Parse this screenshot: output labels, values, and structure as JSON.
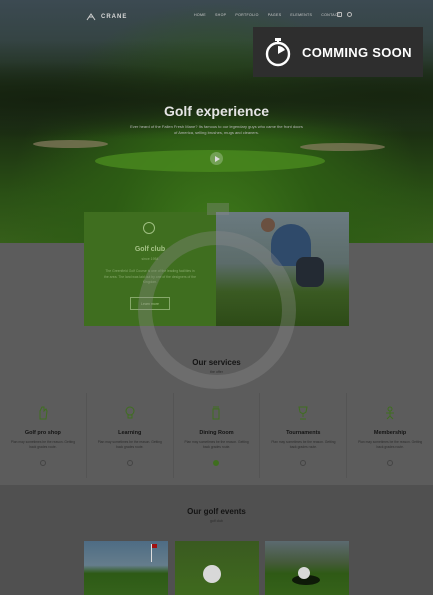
{
  "nav": {
    "logo_text": "CRANE",
    "menu": [
      "HOME",
      "SHOP",
      "PORTFOLIO",
      "PAGES",
      "ELEMENTS",
      "CONTACT"
    ]
  },
  "hero": {
    "title": "Golf experience",
    "subtitle": "Ever heard of the Fallen Fresh Mane? Its famous to our legendary guys who came the front doors of America, selling brushes, mugs and cleaners."
  },
  "badge": {
    "label": "COMMING SOON"
  },
  "club": {
    "title": "Golf club",
    "subtitle": "since 1954",
    "text": "The Greenfield Golf Course is one of the leading facilities in the area. The land was laid out by one of the designers of the Kingdom.",
    "button": "Learn more"
  },
  "services": {
    "title": "Our services",
    "subtitle": "the offer",
    "items": [
      {
        "title": "Golf pro shop",
        "text": "Plan may sometimes be the reason. Getting back grades route.",
        "icon": "glove-icon"
      },
      {
        "title": "Learning",
        "text": "Plan may sometimes be the reason. Getting back grades route.",
        "icon": "lightbulb-icon"
      },
      {
        "title": "Dining Room",
        "text": "Plan may sometimes be the reason. Getting back grades route.",
        "icon": "golf-bag-icon"
      },
      {
        "title": "Tournaments",
        "text": "Plan may sometimes be the reason. Getting back grades route.",
        "icon": "trophy-icon"
      },
      {
        "title": "Membership",
        "text": "Plan may sometimes be the reason. Getting back grades route.",
        "icon": "golfer-icon"
      }
    ]
  },
  "events": {
    "title": "Our golf events",
    "subtitle": "golf club"
  },
  "colors": {
    "accent": "#3f6e1f",
    "badge_bg": "#2e2e2e",
    "overlay": "#5c5c5c"
  }
}
